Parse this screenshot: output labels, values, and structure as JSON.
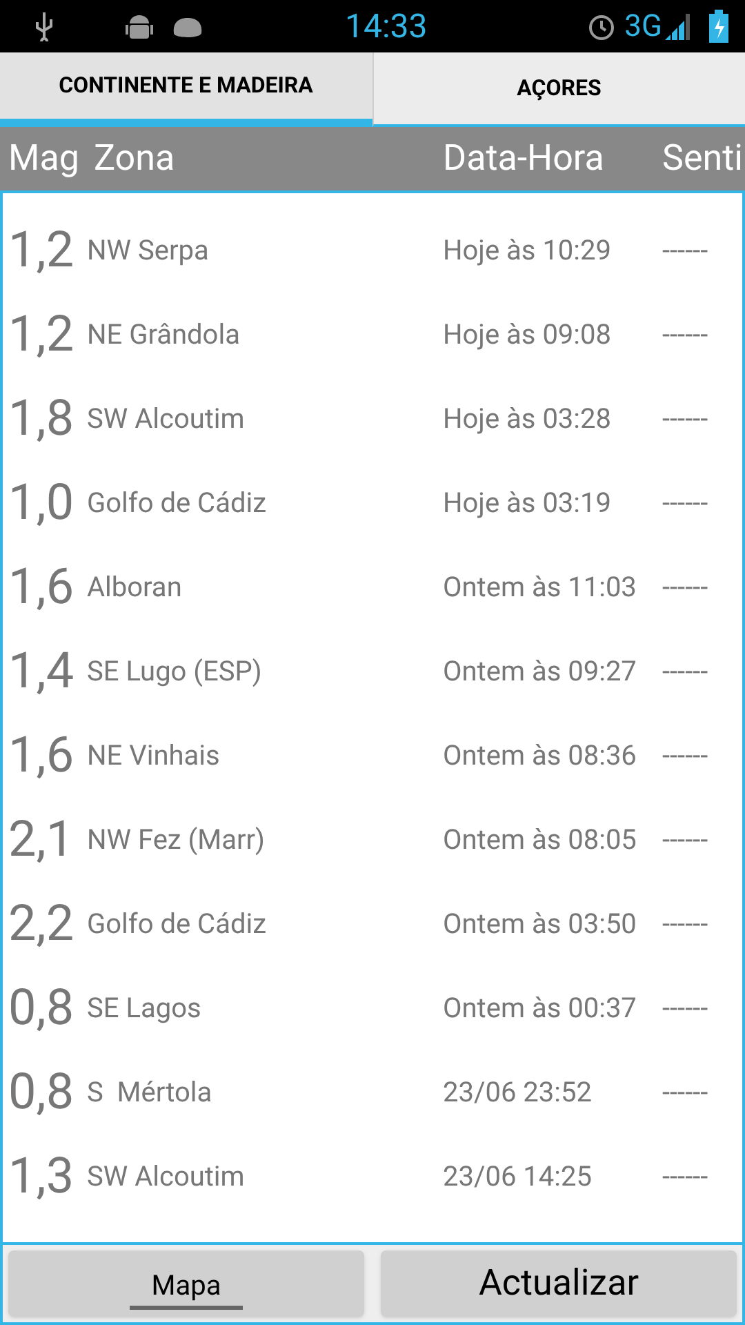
{
  "status_bar": {
    "time": "14:33",
    "network": "3G"
  },
  "tabs": [
    {
      "label": "CONTINENTE E MADEIRA",
      "selected": true
    },
    {
      "label": "AÇORES",
      "selected": false
    }
  ],
  "table": {
    "columns": [
      "Mag",
      "Zona",
      "Data-Hora",
      "Senti"
    ],
    "rows": [
      {
        "mag": "1,2",
        "zone": "NW Serpa",
        "datetime": "Hoje às 10:29",
        "felt": "------"
      },
      {
        "mag": "1,2",
        "zone": "NE Grândola",
        "datetime": "Hoje às 09:08",
        "felt": "------"
      },
      {
        "mag": "1,8",
        "zone": "SW Alcoutim",
        "datetime": "Hoje às 03:28",
        "felt": "------"
      },
      {
        "mag": "1,0",
        "zone": "Golfo de Cádiz",
        "datetime": "Hoje às 03:19",
        "felt": "------"
      },
      {
        "mag": "1,6",
        "zone": "Alboran",
        "datetime": "Ontem às 11:03",
        "felt": "------"
      },
      {
        "mag": "1,4",
        "zone": "SE Lugo (ESP)",
        "datetime": "Ontem às 09:27",
        "felt": "------"
      },
      {
        "mag": "1,6",
        "zone": "NE Vinhais",
        "datetime": "Ontem às 08:36",
        "felt": "------"
      },
      {
        "mag": "2,1",
        "zone": "NW Fez (Marr)",
        "datetime": "Ontem às 08:05",
        "felt": "------"
      },
      {
        "mag": "2,2",
        "zone": "Golfo de Cádiz",
        "datetime": "Ontem às 03:50",
        "felt": "------"
      },
      {
        "mag": "0,8",
        "zone": "SE Lagos",
        "datetime": "Ontem às 00:37",
        "felt": "------"
      },
      {
        "mag": "0,8",
        "zone": "S  Mértola",
        "datetime": "23/06 23:52",
        "felt": "------"
      },
      {
        "mag": "1,3",
        "zone": "SW Alcoutim",
        "datetime": "23/06 14:25",
        "felt": "------"
      }
    ]
  },
  "buttons": [
    {
      "label": "Mapa",
      "kind": "small"
    },
    {
      "label": "Actualizar",
      "kind": "large"
    }
  ]
}
